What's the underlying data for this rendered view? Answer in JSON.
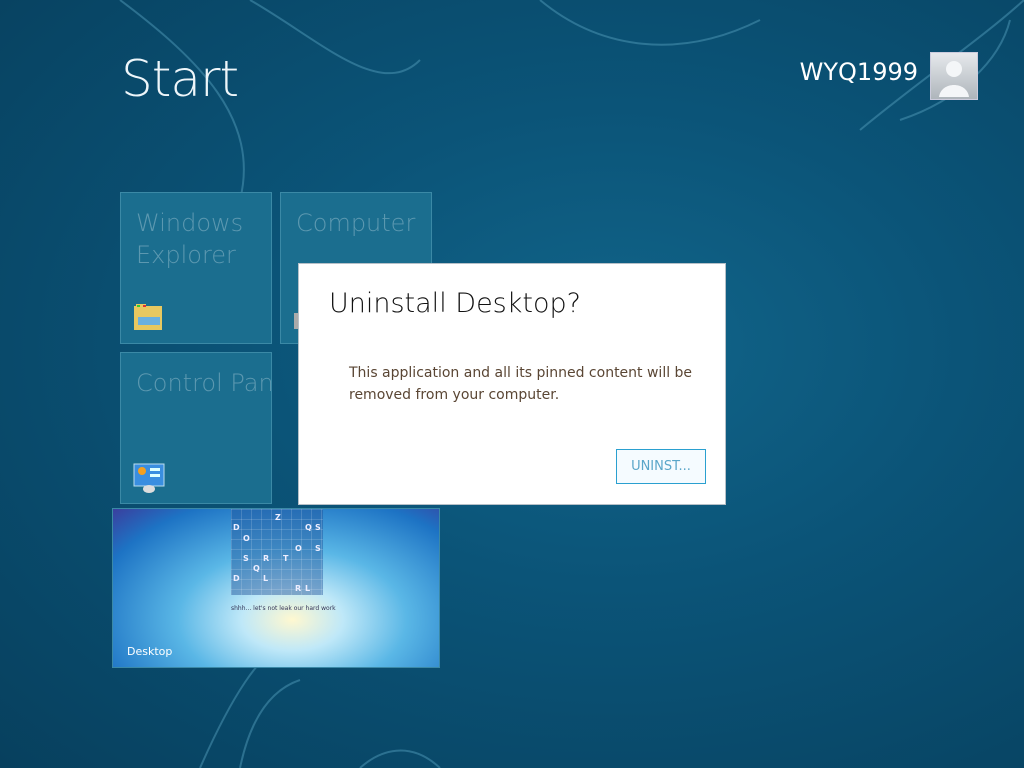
{
  "header": {
    "title": "Start",
    "user_name": "WYQ1999"
  },
  "tiles": [
    {
      "label_line1": "Windows",
      "label_line2": "Explorer",
      "icon": "folder-icon"
    },
    {
      "label_line1": "Computer",
      "icon": "computer-icon"
    },
    {
      "label_line1": "Control Panel",
      "icon": "control-panel-icon"
    }
  ],
  "desktop_tile": {
    "label": "Desktop",
    "preview_caption": "shhh... let's not leak our hard work",
    "preview_letters": [
      "Z",
      "D",
      "Q",
      "S",
      "O",
      "O",
      "S",
      "S",
      "R",
      "T",
      "Q",
      "D",
      "L",
      "R",
      "L"
    ]
  },
  "dialog": {
    "title": "Uninstall Desktop?",
    "message": "This application and all its pinned content will be removed from your computer.",
    "button_label": "UNINST..."
  },
  "colors": {
    "background": "#0b5478",
    "tile": "#1b6e8f",
    "accent": "#2aa0d0"
  }
}
